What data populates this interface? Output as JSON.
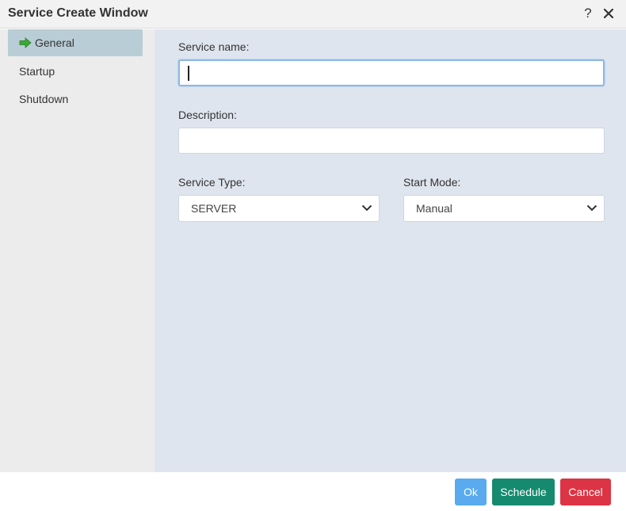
{
  "window": {
    "title": "Service Create Window",
    "help_glyph": "?",
    "close_icon": "close-icon"
  },
  "sidebar": {
    "items": [
      {
        "label": "General",
        "active": true,
        "icon": "green-arrow-right-icon"
      },
      {
        "label": "Startup",
        "active": false
      },
      {
        "label": "Shutdown",
        "active": false
      }
    ]
  },
  "form": {
    "service_name": {
      "label": "Service name:",
      "value": "",
      "placeholder": ""
    },
    "description": {
      "label": "Description:",
      "value": "",
      "placeholder": ""
    },
    "service_type": {
      "label": "Service Type:",
      "selected": "SERVER"
    },
    "start_mode": {
      "label": "Start Mode:",
      "selected": "Manual"
    }
  },
  "footer": {
    "ok_label": "Ok",
    "schedule_label": "Schedule",
    "cancel_label": "Cancel"
  },
  "colors": {
    "active_nav": "#b9cdd6",
    "main_bg": "#dfe5ee",
    "ok": "#5aaaf0",
    "schedule": "#168a6e",
    "cancel": "#dc3444",
    "arrow_green": "#3aa935"
  }
}
